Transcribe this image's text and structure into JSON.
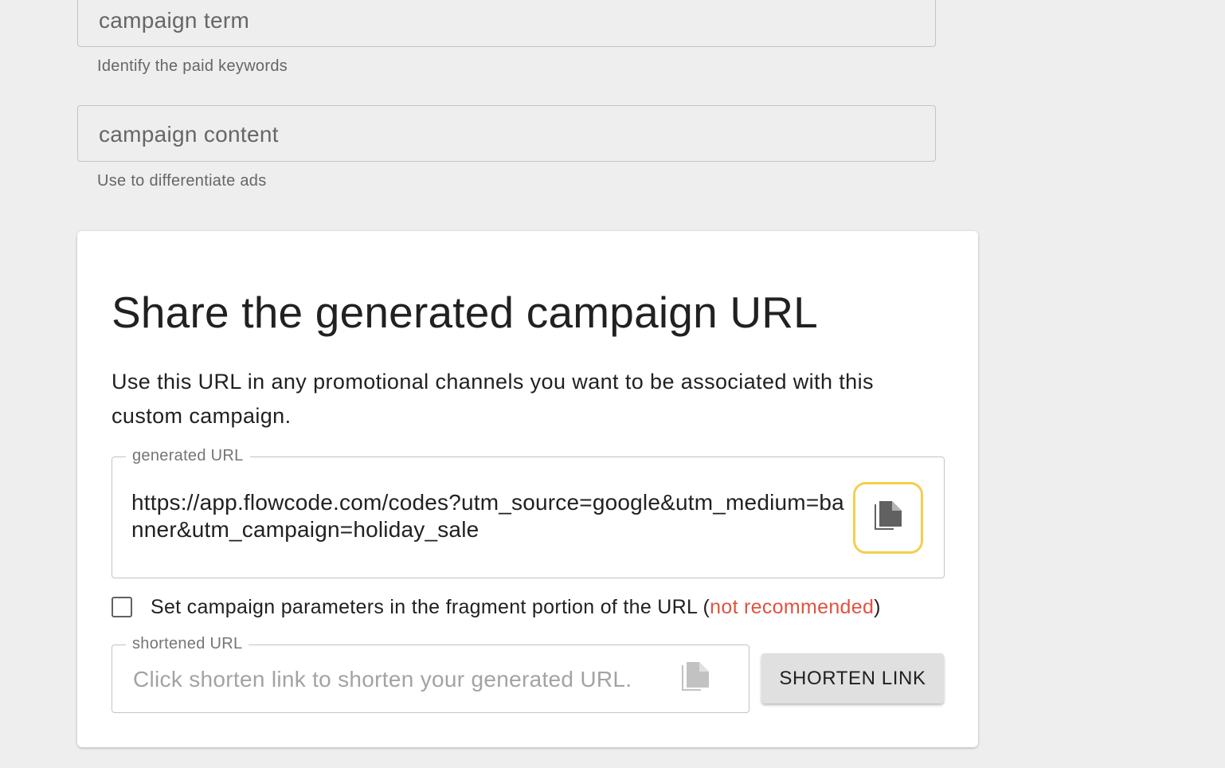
{
  "fields": {
    "campaign_term": {
      "placeholder": "campaign term",
      "helper": "Identify the paid keywords"
    },
    "campaign_content": {
      "placeholder": "campaign content",
      "helper": "Use to differentiate ads"
    }
  },
  "share_card": {
    "title": "Share the generated campaign URL",
    "description": "Use this URL in any promotional channels you want to be associated with this custom campaign.",
    "generated_url": {
      "label": "generated URL",
      "value": "https://app.flowcode.com/codes?utm_source=google&utm_medium=banner&utm_campaign=holiday_sale",
      "copy_icon": "copy-file-icon"
    },
    "fragment_checkbox": {
      "checked": false,
      "label_prefix": "Set campaign parameters in the fragment portion of the URL (",
      "label_warning": "not recommended",
      "label_suffix": ")"
    },
    "shortened_url": {
      "label": "shortened URL",
      "placeholder": "Click shorten link to shorten your generated URL.",
      "copy_icon": "copy-file-icon"
    },
    "shorten_button": "SHORTEN LINK"
  },
  "colors": {
    "background": "#eeeeee",
    "card": "#ffffff",
    "warning": "#e0533e",
    "focus_ring": "#f2cf4f",
    "button": "#e0e0e0"
  }
}
